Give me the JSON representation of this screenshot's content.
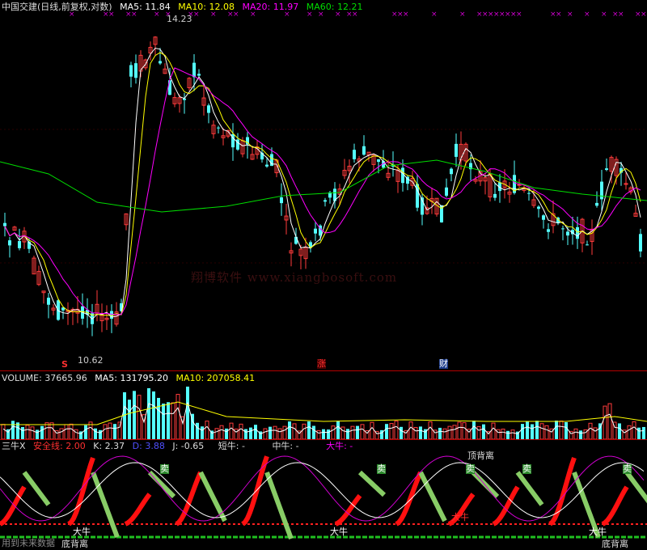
{
  "main": {
    "title": "中国交建(日线,前复权,对数)",
    "ma5_label": "MA5: 11.84",
    "ma10_label": "MA10: 12.08",
    "ma20_label": "MA20: 11.97",
    "ma60_label": "MA60: 12.21",
    "high_label": "14.23",
    "low_label": "10.62",
    "marker_s": "S",
    "marker_zhang": "涨",
    "marker_cai": "财",
    "watermark": "翔博软件 www.xiangbosoft.com",
    "colors": {
      "up": "#ff3b3b",
      "down": "#54ffff",
      "ma5": "#ffffff",
      "ma10": "#ffff00",
      "ma20": "#ff00ff",
      "ma60": "#00dd00"
    }
  },
  "volume": {
    "title": "VOLUME: 37665.96",
    "ma5_label": "MA5: 131795.20",
    "ma10_label": "MA10: 207058.41"
  },
  "indicator": {
    "name": "三牛X",
    "safe_line": "安全线: 2.00",
    "k": "K: 2.37",
    "d": "D: 3.88",
    "j": "J: -0.65",
    "short_bull": "短牛: -",
    "mid_bull": "中牛: -",
    "big_bull": "大牛: -",
    "sell_label": "卖",
    "bull_label": "大牛",
    "bottom_div": "底背离",
    "top_div": "顶背离",
    "footer_text": "用到未来数据"
  }
}
